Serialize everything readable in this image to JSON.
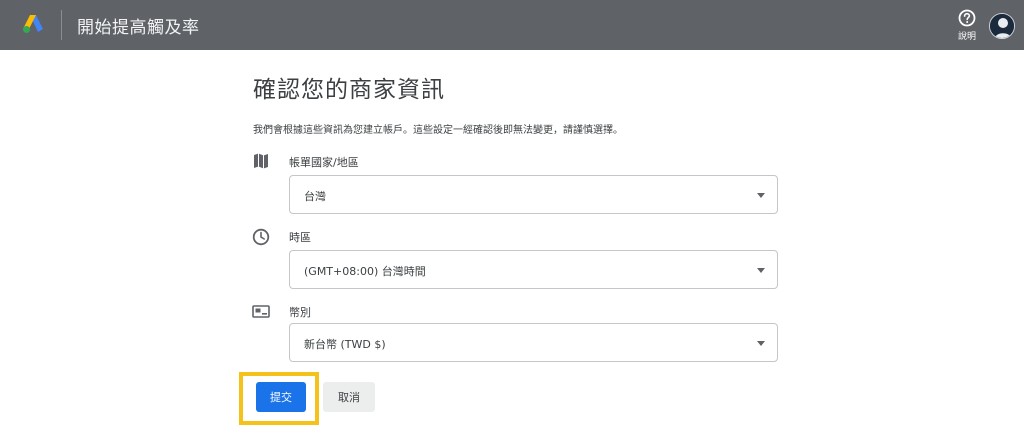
{
  "header": {
    "title": "開始提高觸及率",
    "help_label": "說明",
    "logo_icon": "google-ads-logo",
    "help_icon": "help-circle-icon",
    "avatar_icon": "account-avatar"
  },
  "main": {
    "title": "確認您的商家資訊",
    "notice": "我們會根據這些資訊為您建立帳戶。這些設定一經確認後即無法變更，請謹慎選擇。"
  },
  "fields": {
    "country": {
      "label": "帳單國家/地區",
      "value": "台灣",
      "icon": "map-icon"
    },
    "timezone": {
      "label": "時區",
      "value": "(GMT+08:00) 台灣時間",
      "icon": "clock-icon"
    },
    "currency": {
      "label": "幣別",
      "value": "新台幣 (TWD $)",
      "icon": "currency-icon"
    }
  },
  "actions": {
    "submit_label": "提交",
    "cancel_label": "取消"
  },
  "colors": {
    "topbar": "#5f6266",
    "primary": "#1a73e8",
    "highlight": "#f4c21a"
  }
}
